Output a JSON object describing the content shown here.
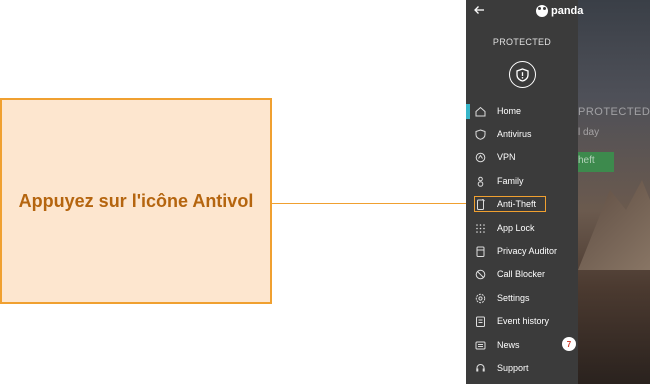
{
  "callout": {
    "text": "Appuyez sur l'icône Antivol"
  },
  "app": {
    "logo_text": "panda",
    "status": "PROTECTED"
  },
  "background": {
    "status": "PROTECTED",
    "subtext": "l day",
    "button_label": "heft"
  },
  "menu": {
    "items": [
      {
        "label": "Home",
        "icon": "home-icon"
      },
      {
        "label": "Antivirus",
        "icon": "shield-icon"
      },
      {
        "label": "VPN",
        "icon": "vpn-icon"
      },
      {
        "label": "Family",
        "icon": "family-icon"
      },
      {
        "label": "Anti-Theft",
        "icon": "phone-icon"
      },
      {
        "label": "App Lock",
        "icon": "keypad-icon"
      },
      {
        "label": "Privacy Auditor",
        "icon": "privacy-icon"
      },
      {
        "label": "Call Blocker",
        "icon": "call-blocker-icon"
      },
      {
        "label": "Settings",
        "icon": "gear-icon"
      },
      {
        "label": "Event history",
        "icon": "history-icon"
      },
      {
        "label": "News",
        "icon": "news-icon",
        "badge": "7"
      },
      {
        "label": "Support",
        "icon": "support-icon"
      }
    ],
    "active": "Home",
    "highlighted": "Anti-Theft"
  },
  "colors": {
    "callout_bg": "#fde6cf",
    "callout_border": "#f0a030",
    "callout_text": "#b5650f",
    "drawer_bg": "#3b3b3b",
    "active_indicator": "#37b5c8"
  }
}
